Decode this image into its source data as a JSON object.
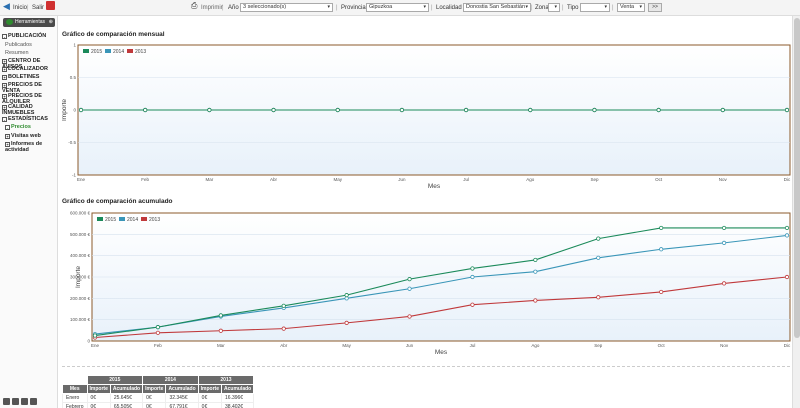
{
  "topbar": {
    "home": "Inicio",
    "logout": "Salir",
    "print": "Imprimir",
    "year_label": "Año",
    "year_value": "3 seleccionado(s)",
    "province_label": "Provincia",
    "province_value": "Gipuzkoa",
    "locality_label": "Localidad",
    "locality_value": "Donostia San Sebastián",
    "zone_label": "Zona",
    "zone_value": "",
    "type_label": "Tipo",
    "type_value": "",
    "operation_value": "Venta",
    "go_label": ">>"
  },
  "sidebar": {
    "tools_label": "Herramientas",
    "items": [
      {
        "label": "PUBLICACIÓN",
        "level": 0,
        "mark": "-"
      },
      {
        "label": "Publicados",
        "level": 1
      },
      {
        "label": "Resumen",
        "level": 1
      },
      {
        "label": "CENTRO DE AVISOS",
        "level": 0,
        "mark": "+"
      },
      {
        "label": "LOCALIZADOR",
        "level": 0,
        "mark": "+"
      },
      {
        "label": "BOLETINES",
        "level": 0,
        "mark": "+"
      },
      {
        "label": "PRECIOS DE VENTA",
        "level": 0,
        "mark": "+"
      },
      {
        "label": "PRECIOS DE ALQUILER",
        "level": 0,
        "mark": "+"
      },
      {
        "label": "CALIDAD INMUEBLES",
        "level": 0,
        "mark": "+"
      },
      {
        "label": "ESTADÍSTICAS",
        "level": 0,
        "mark": "-"
      },
      {
        "label": "Precios",
        "level": 2,
        "mark": "-"
      },
      {
        "label": "Visitas web",
        "level": 2,
        "mark": "+"
      },
      {
        "label": "Informes de actividad",
        "level": 2,
        "mark": "+"
      }
    ]
  },
  "chart_data": [
    {
      "type": "line",
      "title": "Gráfico de comparación mensual",
      "xlabel": "Mes",
      "ylabel": "Importe",
      "categories": [
        "Ene",
        "Feb",
        "Mar",
        "Abr",
        "May",
        "Jun",
        "Jul",
        "Ago",
        "Sep",
        "Oct",
        "Nov",
        "Dic"
      ],
      "yticks": [
        "-1",
        "-0.5",
        "0",
        "0.5",
        "1"
      ],
      "ylim": [
        -1,
        1
      ],
      "legend_position": "top-left",
      "grid": true,
      "series": [
        {
          "name": "2015",
          "color": "#1b8a5a",
          "values": [
            0,
            0,
            0,
            0,
            0,
            0,
            0,
            0,
            0,
            0,
            0,
            0
          ]
        },
        {
          "name": "2014",
          "color": "#3a96b8",
          "values": [
            0,
            0,
            0,
            0,
            0,
            0,
            0,
            0,
            0,
            0,
            0,
            0
          ]
        },
        {
          "name": "2013",
          "color": "#c0393b",
          "values": [
            0,
            0,
            0,
            0,
            0,
            0,
            0,
            0,
            0,
            0,
            0,
            0
          ]
        }
      ]
    },
    {
      "type": "line",
      "title": "Gráfico de comparación acumulado",
      "xlabel": "Mes",
      "ylabel": "Importe",
      "categories": [
        "Ene",
        "Feb",
        "Mar",
        "Abr",
        "May",
        "Jun",
        "Jul",
        "Ago",
        "Sep",
        "Oct",
        "Nov",
        "Dic"
      ],
      "yticks": [
        "0",
        "100.000 €",
        "200.000 €",
        "300.000 €",
        "400.000 €",
        "500.000 €",
        "600.000 €"
      ],
      "ylim": [
        0,
        600000
      ],
      "legend_position": "top-left",
      "grid": true,
      "series": [
        {
          "name": "2015",
          "color": "#1b8a5a",
          "values": [
            25645,
            65000,
            120000,
            165000,
            215000,
            290000,
            340000,
            380000,
            480000,
            530000,
            530000,
            530000
          ]
        },
        {
          "name": "2014",
          "color": "#3a96b8",
          "values": [
            32345,
            65000,
            115000,
            155000,
            200000,
            245000,
            300000,
            325000,
            390000,
            430000,
            460000,
            495000
          ]
        },
        {
          "name": "2013",
          "color": "#c0393b",
          "values": [
            16396,
            38400,
            48000,
            58000,
            85000,
            115000,
            170000,
            190000,
            205000,
            230000,
            270000,
            300000
          ]
        }
      ]
    }
  ],
  "table": {
    "years": [
      "2015",
      "2014",
      "2013"
    ],
    "month_header": "Mes",
    "col_importe": "Importe",
    "col_acumulado": "Acumulado",
    "rows": [
      {
        "mes": "Enero",
        "v": [
          "0€",
          "25.645€",
          "0€",
          "32.345€",
          "0€",
          "16.396€"
        ]
      },
      {
        "mes": "Febrero",
        "v": [
          "0€",
          "65.505€",
          "0€",
          "67.791€",
          "0€",
          "38.402€"
        ]
      }
    ]
  }
}
